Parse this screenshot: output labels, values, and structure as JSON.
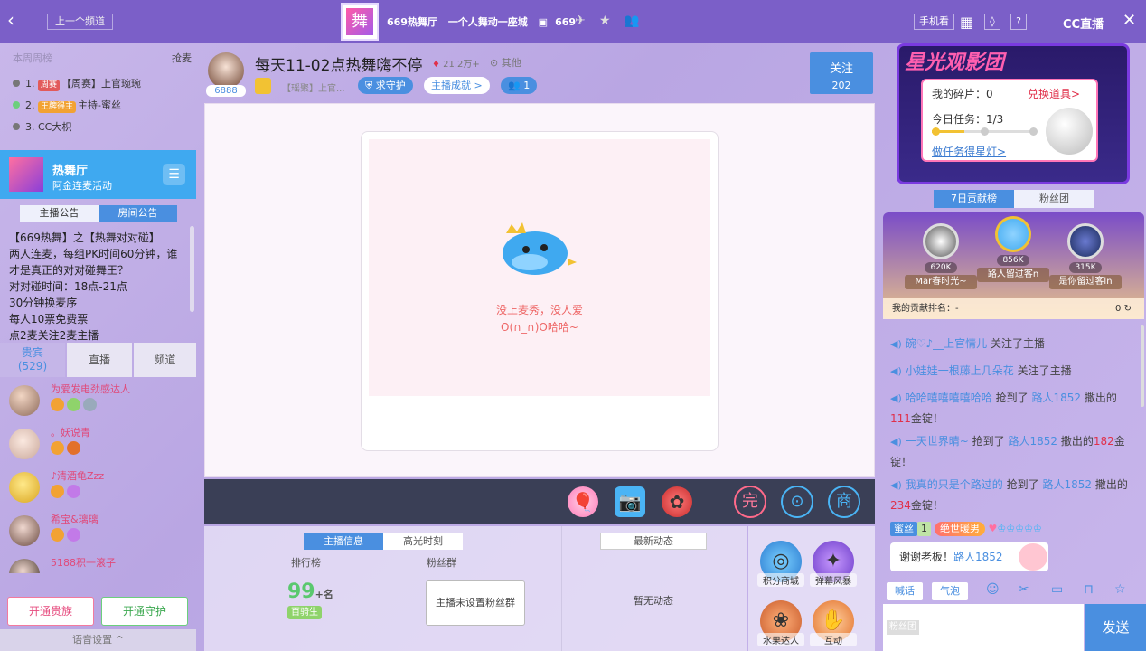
{
  "topbar": {
    "back_icon": "chevron-left-icon",
    "prev_channel": "上一个频道",
    "logo_text": "舞",
    "room_name": "669热舞厅",
    "slogan": "一个人舞动一座城",
    "room_id": "669",
    "phone_watch": "手机看",
    "cc_logo": "CC直播"
  },
  "left": {
    "rank_header": "本周周榜",
    "grab": "抢麦",
    "ranks": [
      {
        "num": "1.",
        "badge": "周赛",
        "name": "【周赛】上官琬琬"
      },
      {
        "num": "2.",
        "badge": "王牌得主",
        "name": "主持-蜜丝"
      },
      {
        "num": "3.",
        "badge": "",
        "name": "CC大枳"
      }
    ],
    "hall": {
      "name": "热舞厅",
      "sub": "阿金连麦活动"
    },
    "notice_tabs": [
      "主播公告",
      "房间公告"
    ],
    "notice_lines": [
      "【669热舞】之【热舞对对碰】",
      "两人连麦，每组PK时间60分钟，谁",
      "才是真正的对对碰舞王？",
      "对对碰时间：18点-21点",
      "30分钟换麦序",
      "每人10票免费票",
      "点2麦关注2麦主播"
    ],
    "user_tabs": {
      "guests": "贵宾",
      "guests_count": "(529)",
      "live": "直播",
      "channel": "频道"
    },
    "users": [
      {
        "name": "为爱发电劲感达人"
      },
      {
        "name": "。妖说青"
      },
      {
        "name": "♪清酒龟Zzz"
      },
      {
        "name": "希宝&璃璃"
      },
      {
        "name": "5188积一滚子"
      }
    ],
    "btn_noble": "开通贵族",
    "btn_guard": "开通守护",
    "voice_setting": "语音设置 ^"
  },
  "stage": {
    "host_level": "6888",
    "title": "每天11-02点热舞嗨不停",
    "heat": "21.2万+",
    "other": "其他",
    "sub": "【瑶聚】上官...",
    "guard_btn": "求守护",
    "achieve_btn": "主播成就 >",
    "fans_count": "1",
    "follow_label": "关注",
    "follow_count": "202",
    "empty_line1": "没上麦秀，没人爱",
    "empty_line2": "O(∩_∩)O哈哈~"
  },
  "bottom": {
    "tabs": [
      "主播信息",
      "高光时刻"
    ],
    "rank_label": "排行榜",
    "fans_label": "粉丝群",
    "rank_value": "99",
    "rank_suffix": "+名",
    "baikou": "百骑生",
    "fans_box": "主播未设置粉丝群",
    "news_btn": "最新动态",
    "no_news": "暂无动态",
    "apps": [
      "积分商城",
      "弹幕风暴",
      "水果达人",
      "互动"
    ]
  },
  "right": {
    "banner_title": "星光观影团",
    "fragments": "我的碎片：0",
    "redeem": "兑换道具>",
    "task": "今日任务：1/3",
    "task_progress": 0.33,
    "do_task": "做任务得星灯>",
    "contrib_tabs": [
      "7日贡献榜",
      "粉丝团"
    ],
    "podium": [
      {
        "score": "620K",
        "name": "Mar春时光~"
      },
      {
        "score": "856K",
        "name": "路人留过客n"
      },
      {
        "score": "315K",
        "name": "是你留过客ln"
      }
    ],
    "my_rank_label": "我的贡献排名：-",
    "my_rank_value": "0",
    "messages": [
      {
        "user": "碗♡♪__上官情儿",
        "action": "关注了主播"
      },
      {
        "user": "小娃娃一根藤上几朵花",
        "action": "关注了主播"
      },
      {
        "user": "哈哈嘻嘻嘻嘻哈哈",
        "mid": "抢到了",
        "target": "路人1852",
        "tail": "撒出的",
        "amount": "111",
        "end": "金锭！"
      },
      {
        "user": "一天世界晴~",
        "mid": "抢到了",
        "target": "路人1852",
        "tail": "撒出的",
        "amount": "182",
        "end": "金锭！"
      },
      {
        "user": "我真的只是个路过的",
        "mid": "抢到了",
        "target": "路人1852",
        "tail": "撒出的",
        "amount": "234",
        "end": "金锭！"
      }
    ],
    "fan_tag": "蜜丝",
    "fan_level": "1",
    "noble_badge": "绝世暖男",
    "thanks_prefix": "谢谢老板！",
    "thanks_user": "路人1852",
    "tool_shout": "喊话",
    "tool_bubble": "气泡",
    "input_tag": "粉丝团",
    "send": "发送"
  }
}
